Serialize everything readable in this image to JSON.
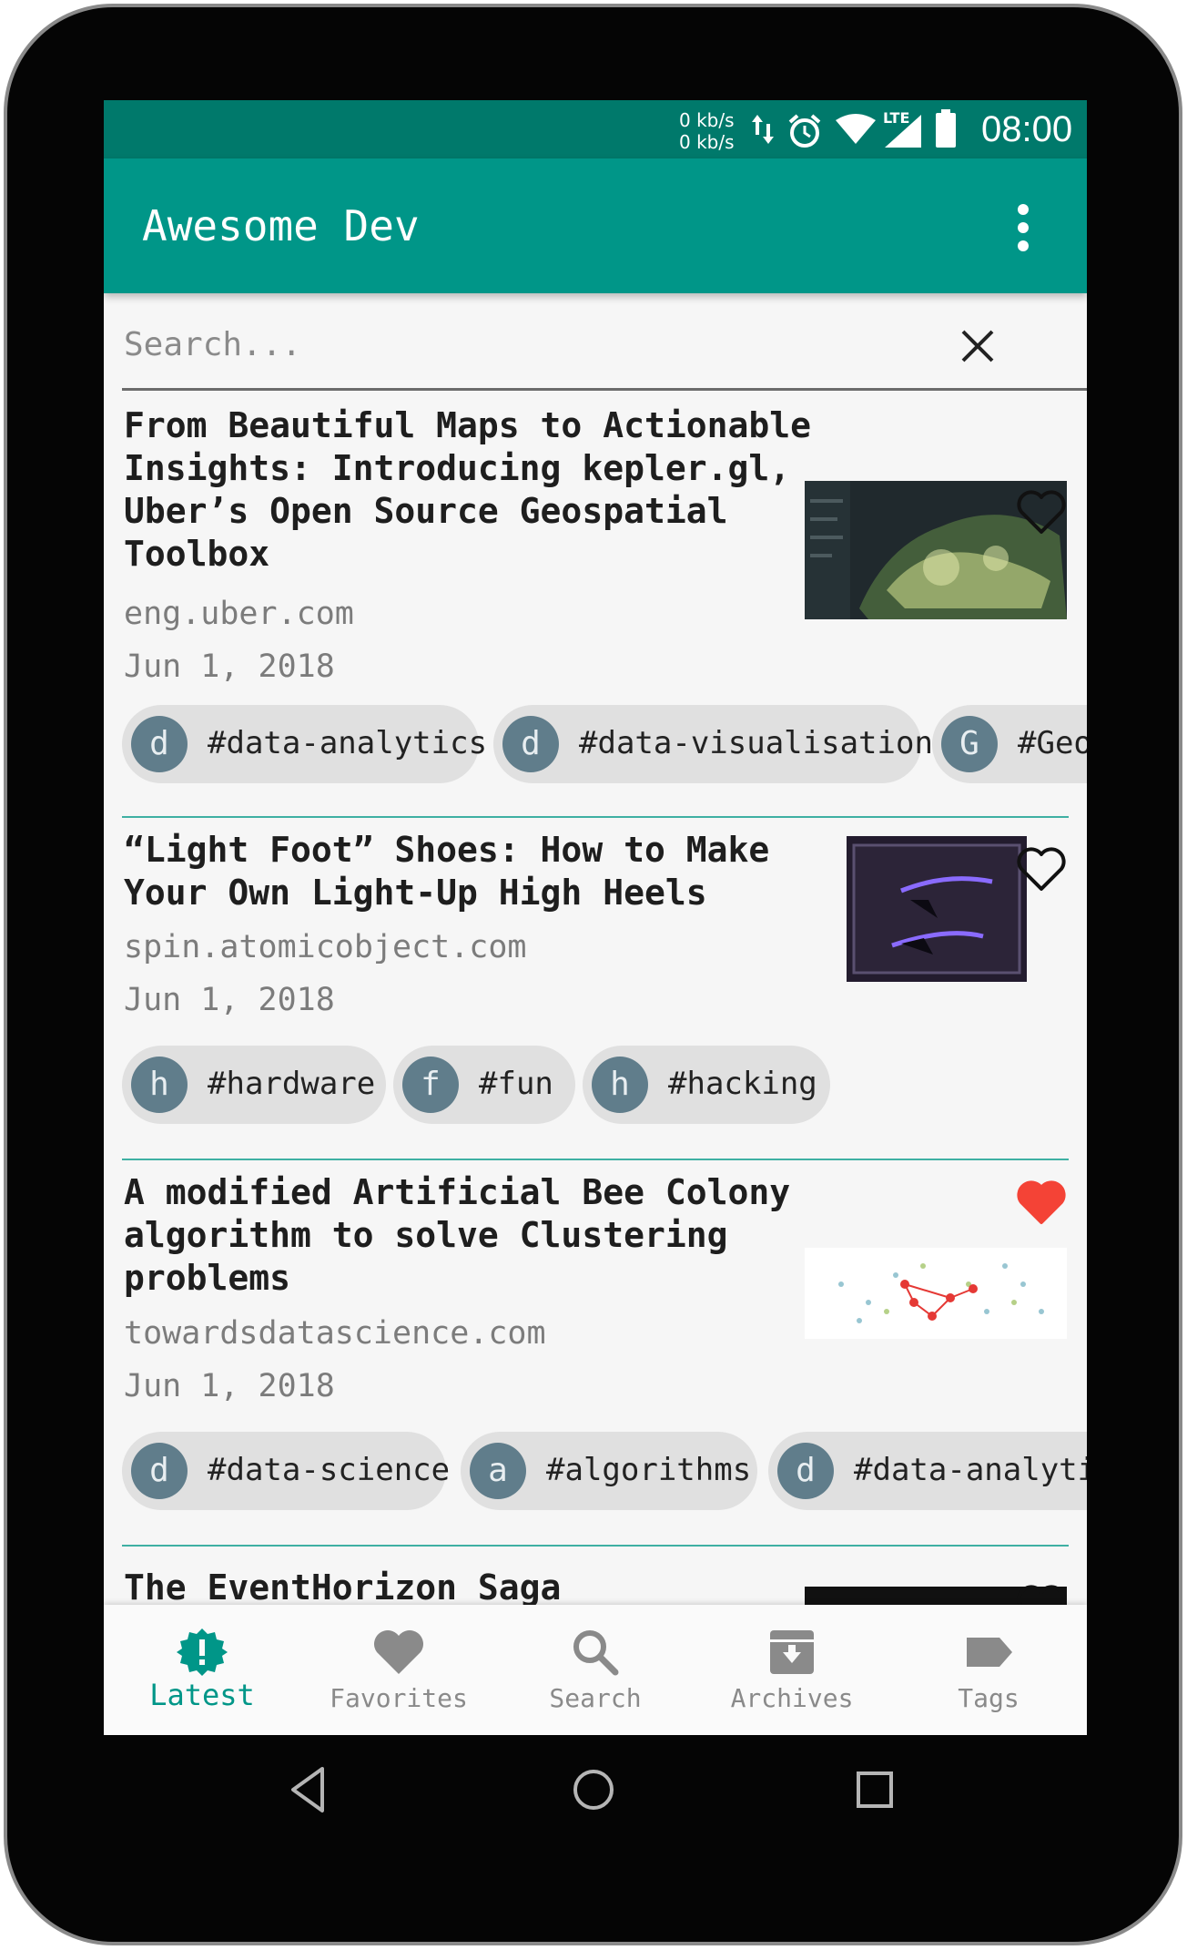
{
  "status_bar": {
    "speed_up": "0 kb/s",
    "speed_down": "0 kb/s",
    "network_label": "LTE",
    "time": "08:00",
    "icons": [
      "data-arrows-icon",
      "alarm-icon",
      "wifi-icon",
      "signal-icon",
      "battery-icon"
    ]
  },
  "app_bar": {
    "title": "Awesome Dev",
    "menu_icon": "more-vert-icon"
  },
  "search": {
    "placeholder": "Search...",
    "value": "",
    "clear_icon": "close-icon"
  },
  "articles": [
    {
      "title": "From Beautiful Maps to Actionable Insights: Introducing kepler.gl, Uber’s Open Source Geospatial Toolbox",
      "source": "eng.uber.com",
      "date": "Jun 1, 2018",
      "favorited": false,
      "tags": [
        {
          "letter": "d",
          "label": "#data-analytics"
        },
        {
          "letter": "d",
          "label": "#data-visualisation"
        },
        {
          "letter": "G",
          "label": "#Geo"
        }
      ]
    },
    {
      "title": "“Light Foot” Shoes: How to Make Your Own Light-Up High Heels",
      "source": "spin.atomicobject.com",
      "date": "Jun 1, 2018",
      "favorited": false,
      "tags": [
        {
          "letter": "h",
          "label": "#hardware"
        },
        {
          "letter": "f",
          "label": "#fun"
        },
        {
          "letter": "h",
          "label": "#hacking"
        }
      ]
    },
    {
      "title": "A modified Artificial Bee Colony algorithm to solve Clustering problems",
      "source": "towardsdatascience.com",
      "date": "Jun 1, 2018",
      "favorited": true,
      "tags": [
        {
          "letter": "d",
          "label": "#data-science"
        },
        {
          "letter": "a",
          "label": "#algorithms"
        },
        {
          "letter": "d",
          "label": "#data-analytic"
        }
      ]
    },
    {
      "title": "The EventHorizon Saga",
      "favorited": false
    }
  ],
  "bottom_nav": [
    {
      "label": "Latest",
      "icon": "alert-badge-icon",
      "active": true
    },
    {
      "label": "Favorites",
      "icon": "heart-icon",
      "active": false
    },
    {
      "label": "Search",
      "icon": "search-icon",
      "active": false
    },
    {
      "label": "Archives",
      "icon": "archive-icon",
      "active": false
    },
    {
      "label": "Tags",
      "icon": "tag-icon",
      "active": false
    }
  ],
  "colors": {
    "primary": "#009688",
    "primary_dark": "#00796b",
    "favorite": "#f44336",
    "tag_avatar": "#607d8b"
  }
}
